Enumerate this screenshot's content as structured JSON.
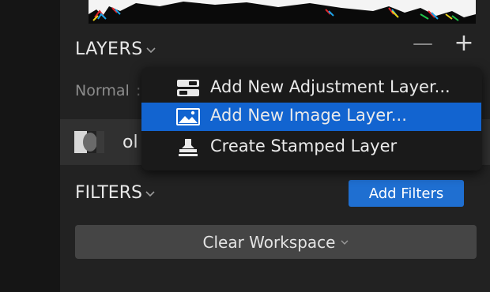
{
  "layers_panel": {
    "title": "LAYERS",
    "minus_label": "—",
    "plus_label": "+",
    "blend_mode": "Normal",
    "layer_name_partial": "ol"
  },
  "context_menu": {
    "items": [
      {
        "label": "Add New Adjustment Layer...",
        "icon": "adjustment-layer-icon"
      },
      {
        "label": "Add New Image Layer...",
        "icon": "image-layer-icon",
        "selected": true
      },
      {
        "label": "Create Stamped Layer",
        "icon": "stamp-icon"
      }
    ]
  },
  "filters_panel": {
    "title": "FILTERS",
    "add_label": "Add Filters",
    "clear_label": "Clear Workspace"
  },
  "colors": {
    "accent": "#1264d0",
    "button_blue": "#1f6fd1",
    "panel_bg": "#222222",
    "menu_bg": "#1a1a1a"
  }
}
